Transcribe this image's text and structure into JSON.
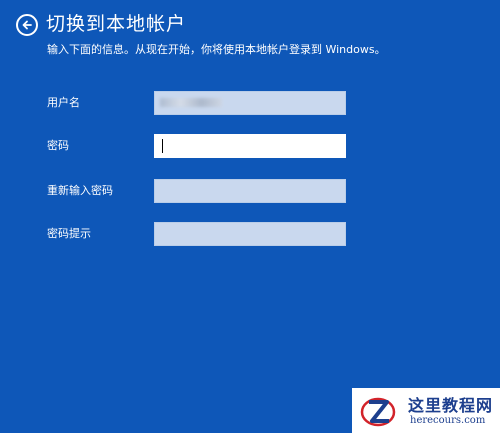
{
  "page": {
    "title": "切换到本地帐户",
    "subtitle": "输入下面的信息。从现在开始，你将使用本地帐户登录到 Windows。"
  },
  "form": {
    "fields": [
      {
        "label": "用户名",
        "value": ""
      },
      {
        "label": "密码",
        "value": ""
      },
      {
        "label": "重新输入密码",
        "value": ""
      },
      {
        "label": "密码提示",
        "value": ""
      }
    ]
  },
  "watermark": {
    "title": "这里教程网",
    "url": "herecours.com"
  },
  "colors": {
    "background": "#0E57B8",
    "input_inactive": "#C9D8EE",
    "input_active": "#FFFFFF"
  },
  "icons": {
    "back": "back-arrow-icon",
    "logo": "z-logo-icon"
  }
}
